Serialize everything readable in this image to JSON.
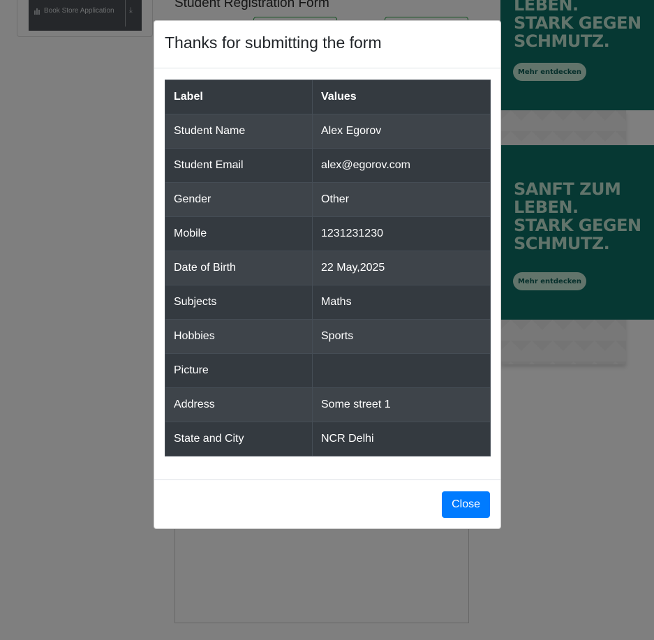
{
  "background": {
    "sidebar_item_label": "Book Store Application",
    "form_title": "Student Registration Form"
  },
  "ads": {
    "top_text": "LEBEN.\nSTARK GEGEN\nSCHMUTZ.",
    "mid_text": "SANFT ZUM\nLEBEN.\nSTARK GEGEN\nSCHMUTZ.",
    "button_label": "Mehr entdecken"
  },
  "modal": {
    "title": "Thanks for submitting the form",
    "headers": [
      "Label",
      "Values"
    ],
    "rows": [
      {
        "label": "Student Name",
        "value": "Alex Egorov"
      },
      {
        "label": "Student Email",
        "value": "alex@egorov.com"
      },
      {
        "label": "Gender",
        "value": "Other"
      },
      {
        "label": "Mobile",
        "value": "1231231230"
      },
      {
        "label": "Date of Birth",
        "value": "22 May,2025"
      },
      {
        "label": "Subjects",
        "value": "Maths"
      },
      {
        "label": "Hobbies",
        "value": "Sports"
      },
      {
        "label": "Picture",
        "value": ""
      },
      {
        "label": "Address",
        "value": "Some street 1"
      },
      {
        "label": "State and City",
        "value": "NCR Delhi"
      }
    ],
    "close_label": "Close"
  },
  "colors": {
    "primary": "#007bff",
    "table_dark": "#343a40",
    "table_stripe": "#3e444a",
    "ad_green": "#0c7067"
  }
}
